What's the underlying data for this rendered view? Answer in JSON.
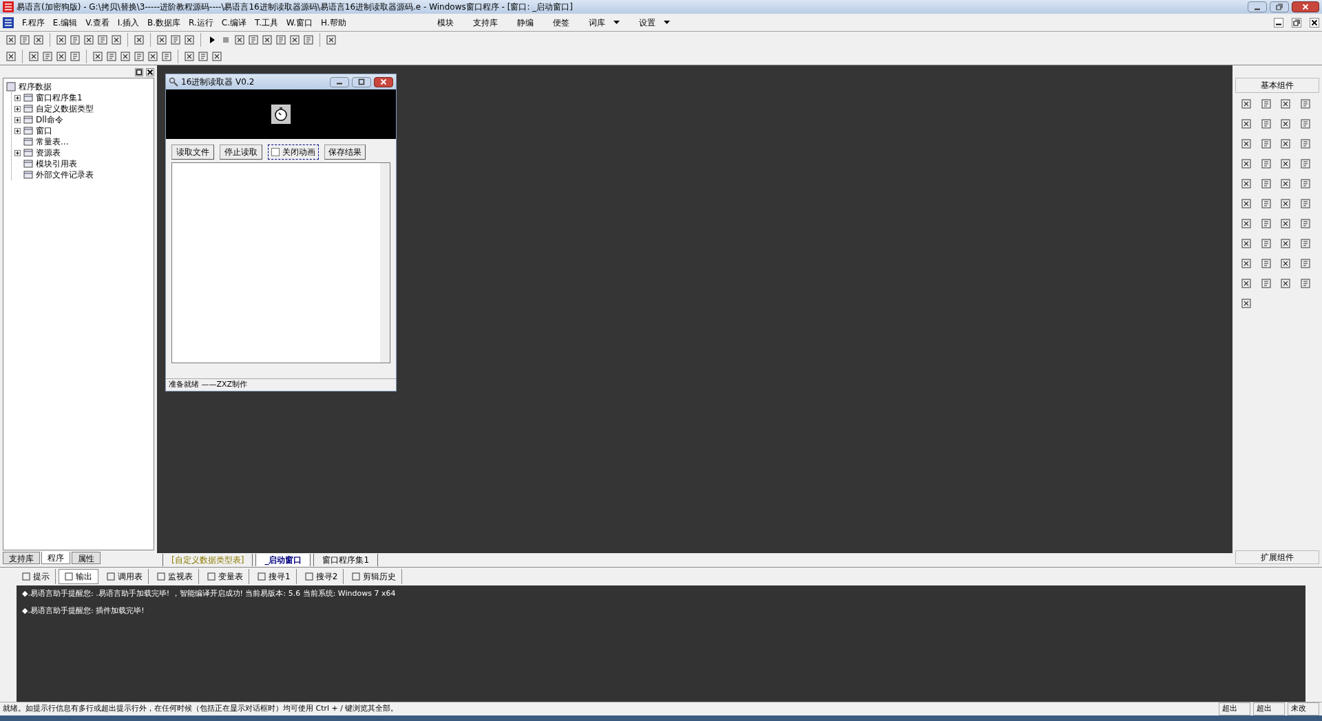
{
  "window": {
    "title": "易语言(加密狗版) - G:\\拷贝\\替换\\3-----进阶教程源码----\\易语言16进制读取器源码\\易语言16进制读取器源码.e - Windows窗口程序 - [窗口: _启动窗口]"
  },
  "menu": [
    "F.程序",
    "E.编辑",
    "V.查看",
    "I.插入",
    "B.数据库",
    "R.运行",
    "C.编译",
    "T.工具",
    "W.窗口",
    "H.帮助"
  ],
  "menu_right": [
    {
      "label": "模块",
      "dropdown": false
    },
    {
      "label": "支持库",
      "dropdown": false
    },
    {
      "label": "静编",
      "dropdown": false
    },
    {
      "label": "便签",
      "dropdown": false
    },
    {
      "label": "词库",
      "dropdown": true
    },
    {
      "label": "设置",
      "dropdown": true
    }
  ],
  "tree": {
    "label": "程序数据",
    "children": [
      {
        "label": "窗口程序集1",
        "expanded": false
      },
      {
        "label": "自定义数据类型",
        "expanded": false
      },
      {
        "label": "Dll命令",
        "expanded": false
      },
      {
        "label": "窗口",
        "expanded": false
      },
      {
        "label": "常量表..."
      },
      {
        "label": "资源表",
        "expanded": false
      },
      {
        "label": "模块引用表"
      },
      {
        "label": "外部文件记录表"
      }
    ]
  },
  "left_tabs": [
    {
      "label": "支持库",
      "selected": false
    },
    {
      "label": "程序",
      "selected": true
    },
    {
      "label": "属性",
      "selected": false
    }
  ],
  "form": {
    "title": "16进制读取器 V0.2",
    "buttons": [
      "读取文件",
      "停止读取"
    ],
    "checkbox": {
      "label": "关闭动画",
      "checked": false
    },
    "save_button": "保存结果",
    "status": "准备就绪 ——ZXZ制作"
  },
  "editor_tabs": [
    {
      "label": "[自定义数据类型表]",
      "selected": false
    },
    {
      "label": "_启动窗口",
      "selected": true
    },
    {
      "label": "窗口程序集1",
      "selected": false
    }
  ],
  "components": {
    "title": "基本组件",
    "footer": "扩展组件"
  },
  "bottom_tabs": [
    {
      "label": "提示",
      "selected": false
    },
    {
      "label": "输出",
      "selected": true
    },
    {
      "label": "调用表",
      "selected": false
    },
    {
      "label": "监视表",
      "selected": false
    },
    {
      "label": "变量表",
      "selected": false
    },
    {
      "label": "搜寻1",
      "selected": false
    },
    {
      "label": "搜寻2",
      "selected": false
    },
    {
      "label": "剪辑历史",
      "selected": false
    }
  ],
  "output": [
    "◆.易语言助手提醒您: .易语言助手加载完毕! ，智能编译开启成功! 当前易版本: 5.6 当前系统: Windows 7 x64",
    "◆.易语言助手提醒您: 插件加载完毕!"
  ],
  "status_bar": {
    "text": "就绪。如提示行信息有多行或超出提示行外，在任何时候（包括正在显示对话框时）均可使用 Ctrl + / 键浏览其全部。",
    "cells": [
      "超出",
      "超出",
      "未改"
    ]
  }
}
